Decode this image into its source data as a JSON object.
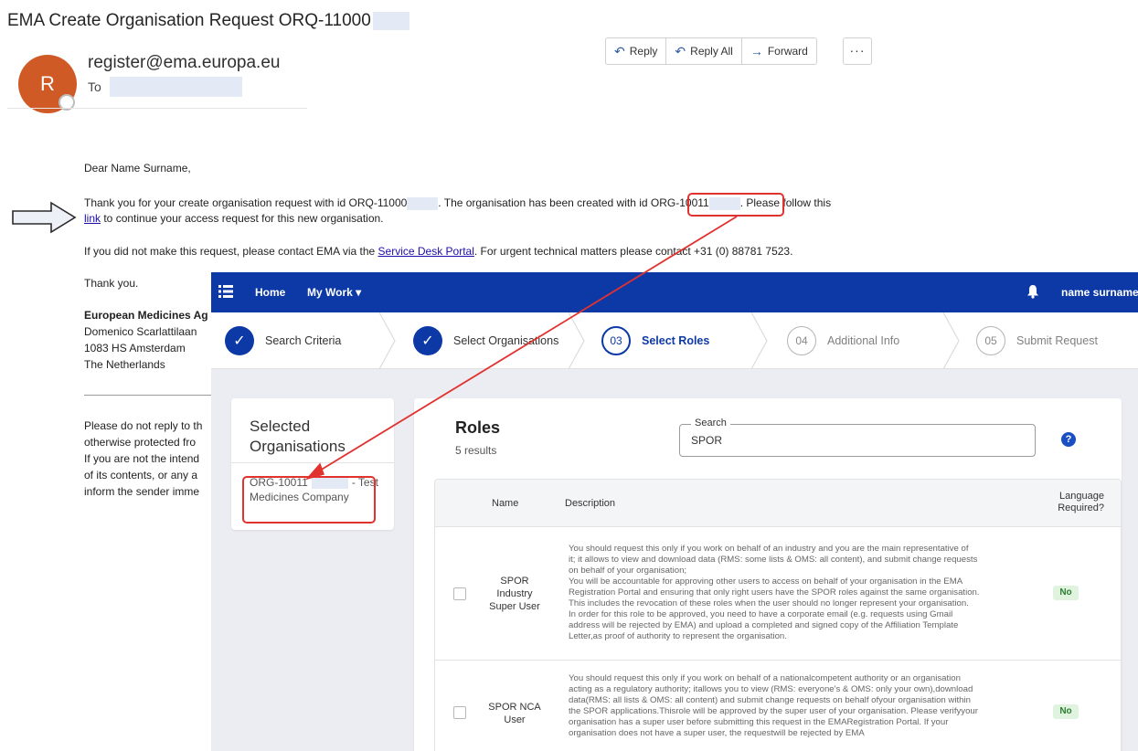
{
  "email": {
    "subject": "EMA Create Organisation Request ORQ-11000",
    "avatar_initial": "R",
    "sender": "register@ema.europa.eu",
    "to_label": "To",
    "actions": {
      "reply": "Reply",
      "reply_all": "Reply All",
      "forward": "Forward",
      "more": "···"
    },
    "body": {
      "greeting": "Dear Name Surname,",
      "p1_a": "Thank you for your create organisation request with id ORQ-11000",
      "p1_b": ". The organisation has been created with id ",
      "org_id": "ORG-10011",
      "p1_c": ". Please follow this",
      "link_text": "link",
      "p1_d": " to continue your access request for this new organisation.",
      "p2_a": "If you did not make this request, please contact EMA via the ",
      "service_desk_link": "Service Desk Portal",
      "p2_b": ". For urgent technical matters please contact +31 (0) 88781 7523.",
      "thanks": "Thank you.",
      "sig_org": "European Medicines Ag",
      "sig_addr1": "Domenico Scarlattilaan",
      "sig_addr2": "1083 HS Amsterdam",
      "sig_addr3": "The Netherlands",
      "disc1": "Please do not reply to th",
      "disc2": "otherwise protected fro",
      "disc3": "If you are not the intend",
      "disc4": "of its contents, or any a",
      "disc5": "inform the sender imme"
    }
  },
  "app": {
    "nav": {
      "home": "Home",
      "my_work": "My Work ▾",
      "user": "name surname"
    },
    "steps": [
      {
        "num": "✓",
        "label": "Search Criteria",
        "state": "done"
      },
      {
        "num": "✓",
        "label": "Select Organisations",
        "state": "done"
      },
      {
        "num": "03",
        "label": "Select Roles",
        "state": "active"
      },
      {
        "num": "04",
        "label": "Additional Info",
        "state": "pending"
      },
      {
        "num": "05",
        "label": "Submit Request",
        "state": "pending"
      }
    ],
    "selected_orgs": {
      "title_line1": "Selected",
      "title_line2": "Organisations",
      "org_line1_a": "ORG-10011",
      "org_line1_b": "- Test",
      "org_line2": "Medicines Company"
    },
    "roles": {
      "title": "Roles",
      "results": "5 results",
      "search_label": "Search",
      "search_value": "SPOR",
      "help": "?",
      "columns": {
        "name": "Name",
        "description": "Description",
        "language_1": "Language",
        "language_2": "Required?"
      },
      "rows": [
        {
          "name_lines": [
            "SPOR",
            "Industry",
            "Super User"
          ],
          "description_lines": [
            "You should request this only if you work on behalf of an industry and you are the main representative of",
            "it; it allows to view and download data (RMS: some lists & OMS: all content), and submit change requests",
            "on behalf of your organisation;",
            "You will be accountable for approving other users to access on behalf of your organisation in the EMA",
            "Registration Portal and ensuring that only right users have the SPOR roles against the same organisation.",
            "This includes the revocation of these roles when the user should no longer represent your organisation.",
            "In order for this role to be approved, you need to have a corporate email (e.g. requests using Gmail",
            "address will be rejected by EMA) and upload a completed and signed copy of the Affiliation Template",
            "Letter,as proof of authority to represent the organisation."
          ],
          "language_required": "No"
        },
        {
          "name_lines": [
            "SPOR NCA",
            "User"
          ],
          "description_lines": [
            "You should request this only if you work on behalf of a nationalcompetent authority or an organisation",
            "acting as a regulatory authority; itallows you to view (RMS: everyone's & OMS: only your own),download",
            "data(RMS: all lists & OMS: all content) and submit change requests on behalf ofyour organisation within",
            "the SPOR applications.Thisrole will be approved by the super user of your organisation. Please verifyyour",
            "organisation has a super user before submitting this request in the EMARegistration Portal. If your",
            "organisation does not have a super user, the requestwill be rejected by EMA"
          ],
          "language_required": "No"
        }
      ]
    }
  },
  "colors": {
    "nav_bg": "#0d39a6",
    "avatar": "#d05a26",
    "highlight": "#e0322f",
    "link": "#1a0dab"
  }
}
